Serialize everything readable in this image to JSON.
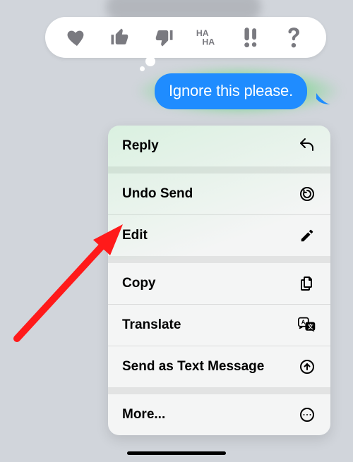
{
  "tapback": {
    "reactions": [
      "heart",
      "thumbs-up",
      "thumbs-down",
      "haha",
      "exclaim",
      "question"
    ]
  },
  "message": {
    "text": "Ignore this please."
  },
  "menu": {
    "reply": "Reply",
    "undo_send": "Undo Send",
    "edit": "Edit",
    "copy": "Copy",
    "translate": "Translate",
    "send_as_text": "Send as Text Message",
    "more": "More..."
  },
  "colors": {
    "bubble": "#1f8cff",
    "glow": "#32d94b",
    "arrow": "#ff1a1a"
  }
}
